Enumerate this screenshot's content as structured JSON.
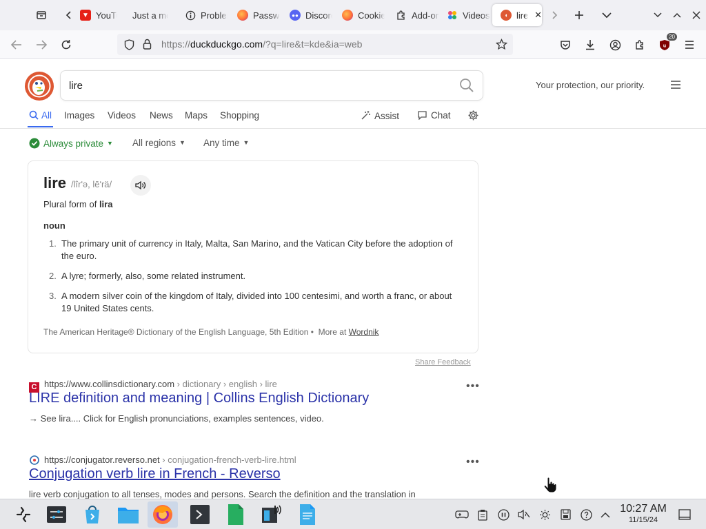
{
  "browser": {
    "tabs": [
      {
        "title": "YouTube",
        "favicon": "youtube-icon",
        "color": "#e62117"
      },
      {
        "title": "Just a moment",
        "favicon": "",
        "color": ""
      },
      {
        "title": "Problems",
        "favicon": "info-circle-icon",
        "color": "#333333"
      },
      {
        "title": "Password",
        "favicon": "firefox-icon",
        "color": "#ff7139"
      },
      {
        "title": "Discord",
        "favicon": "discord-icon",
        "color": "#5865f2"
      },
      {
        "title": "Cookies",
        "favicon": "firefox-icon",
        "color": "#ff7139"
      },
      {
        "title": "Add-ons",
        "favicon": "puzzle-icon",
        "color": "#333333"
      },
      {
        "title": "Videos",
        "favicon": "shapes-icon",
        "color": "#e94e77"
      },
      {
        "title": "lire",
        "favicon": "duckduckgo-icon",
        "color": "#de5833",
        "active": true
      }
    ],
    "url": {
      "prefix": "https://",
      "host": "duckduckgo.com",
      "rest": "/?q=lire&t=kde&ia=web"
    },
    "extension_badge": "20"
  },
  "ddg": {
    "query": "lire",
    "tagline": "Your protection, our priority.",
    "tabs": [
      "All",
      "Images",
      "Videos",
      "News",
      "Maps",
      "Shopping"
    ],
    "assist": "Assist",
    "chat": "Chat",
    "filters": {
      "privacy": "Always private",
      "region": "All regions",
      "time": "Any time"
    }
  },
  "dictionary": {
    "word": "lire",
    "pronunciation": "/lîrʹə, lēʹrä/",
    "plural_prefix": "Plural form of",
    "plural_word": "lira",
    "part_of_speech": "noun",
    "definitions": [
      {
        "num": "1.",
        "text": "The primary unit of currency in Italy, Malta, San Marino, and the Vatican City before the adoption of the euro."
      },
      {
        "num": "2.",
        "text": "A lyre; formerly, also, some related instrument."
      },
      {
        "num": "3.",
        "text": "A modern silver coin of the kingdom of Italy, divided into 100 centesimi, and worth a franc, or about 19 United States cents."
      }
    ],
    "source": "The American Heritage® Dictionary of the English Language, 5th Edition •",
    "more_at": "More at",
    "more_link": "Wordnik",
    "feedback": "Share Feedback"
  },
  "results": [
    {
      "host": "https://www.collinsdictionary.com",
      "path": " › dictionary › english › lire",
      "title": "LIRE definition and meaning | Collins English Dictionary",
      "snippet": "→ See lira.... Click for English pronunciations, examples sentences, video.",
      "favicon_color": "#c8102e"
    },
    {
      "host": "https://conjugator.reverso.net",
      "path": " › conjugation-french-verb-lire.html",
      "title": "Conjugation verb lire in French - Reverso",
      "snippet": "lire verb conjugation to all tenses, modes and persons. Search the definition and the translation in",
      "favicon_color": "#2b6cb0"
    }
  ],
  "taskbar": {
    "time": "10:27 AM",
    "date": "11/15/24"
  }
}
